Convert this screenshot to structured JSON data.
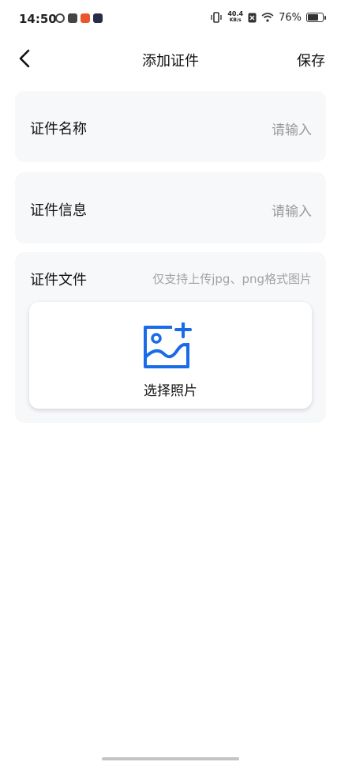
{
  "status_bar": {
    "time": "14:50",
    "net_speed_value": "40.4",
    "net_speed_unit": "KB/s",
    "battery_percent": "76%",
    "battery_level": 0.76
  },
  "nav": {
    "title": "添加证件",
    "save_label": "保存"
  },
  "form": {
    "cert_name": {
      "label": "证件名称",
      "placeholder": "请输入"
    },
    "cert_info": {
      "label": "证件信息",
      "placeholder": "请输入"
    },
    "cert_file": {
      "label": "证件文件",
      "hint": "仅支持上传jpg、png格式图片",
      "select_photo_label": "选择照片"
    }
  },
  "colors": {
    "accent": "#1a6be8",
    "card_bg": "#f7f8fa",
    "placeholder": "#9a9a9a"
  }
}
